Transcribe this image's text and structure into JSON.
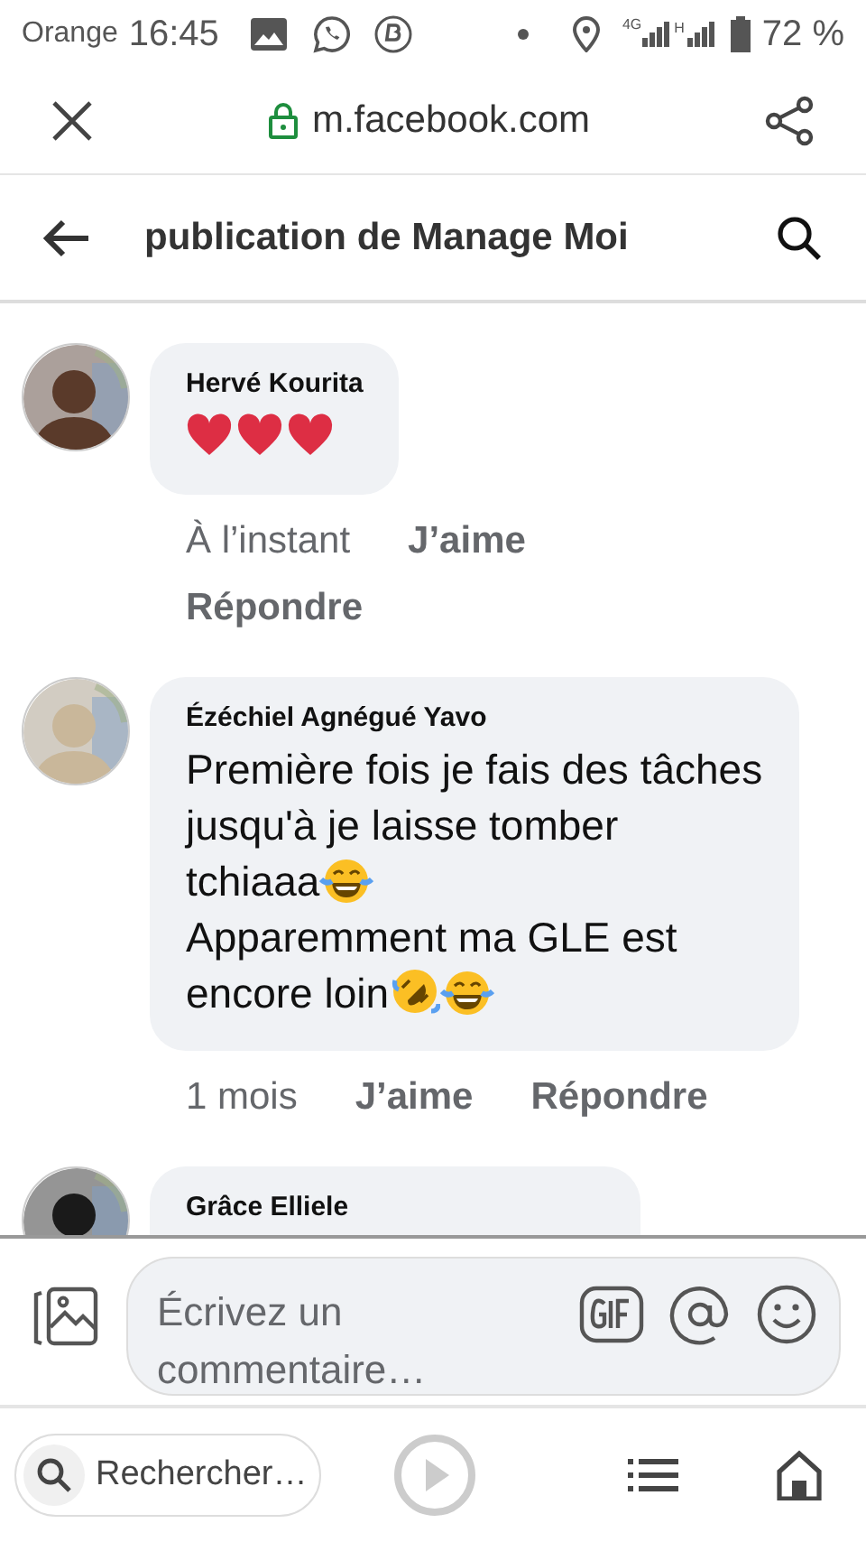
{
  "status_bar": {
    "carrier": "Orange",
    "time": "16:45",
    "network": "4G",
    "network_2": "H",
    "battery": "72 %"
  },
  "browser": {
    "url": "m.facebook.com"
  },
  "header": {
    "title": "publication de Manage Moi"
  },
  "comments": [
    {
      "author": "Hervé Kourita",
      "kind": "picture",
      "body": [
        [
          {
            "kind": "heart"
          },
          {
            "kind": "heart"
          },
          {
            "kind": "heart"
          }
        ]
      ],
      "time": "À l’instant",
      "like": "J’aime",
      "reply": "Répondre"
    },
    {
      "author": "Ézéchiel Agnégué Yavo",
      "kind": "picture",
      "body": [
        [
          {
            "kind": "text",
            "text": "Première fois je fais des tâches"
          }
        ],
        [
          {
            "kind": "text",
            "text": "jusqu'à je laisse tomber"
          }
        ],
        [
          {
            "kind": "text",
            "text": "tchiaaa"
          },
          {
            "kind": "laugh"
          }
        ],
        [
          {
            "kind": "text",
            "text": "Apparemment ma GLE est"
          }
        ],
        [
          {
            "kind": "text",
            "text": "encore loin"
          },
          {
            "kind": "rofl"
          },
          {
            "kind": "laugh"
          }
        ]
      ],
      "time": "1 mois",
      "like": "J’aime",
      "reply": "Répondre"
    },
    {
      "author": "Grâce Elliele",
      "kind": "picture"
    }
  ],
  "composer": {
    "placeholder": "Écrivez un commentaire…"
  },
  "bottom_bar": {
    "search_placeholder": "Rechercher…"
  }
}
